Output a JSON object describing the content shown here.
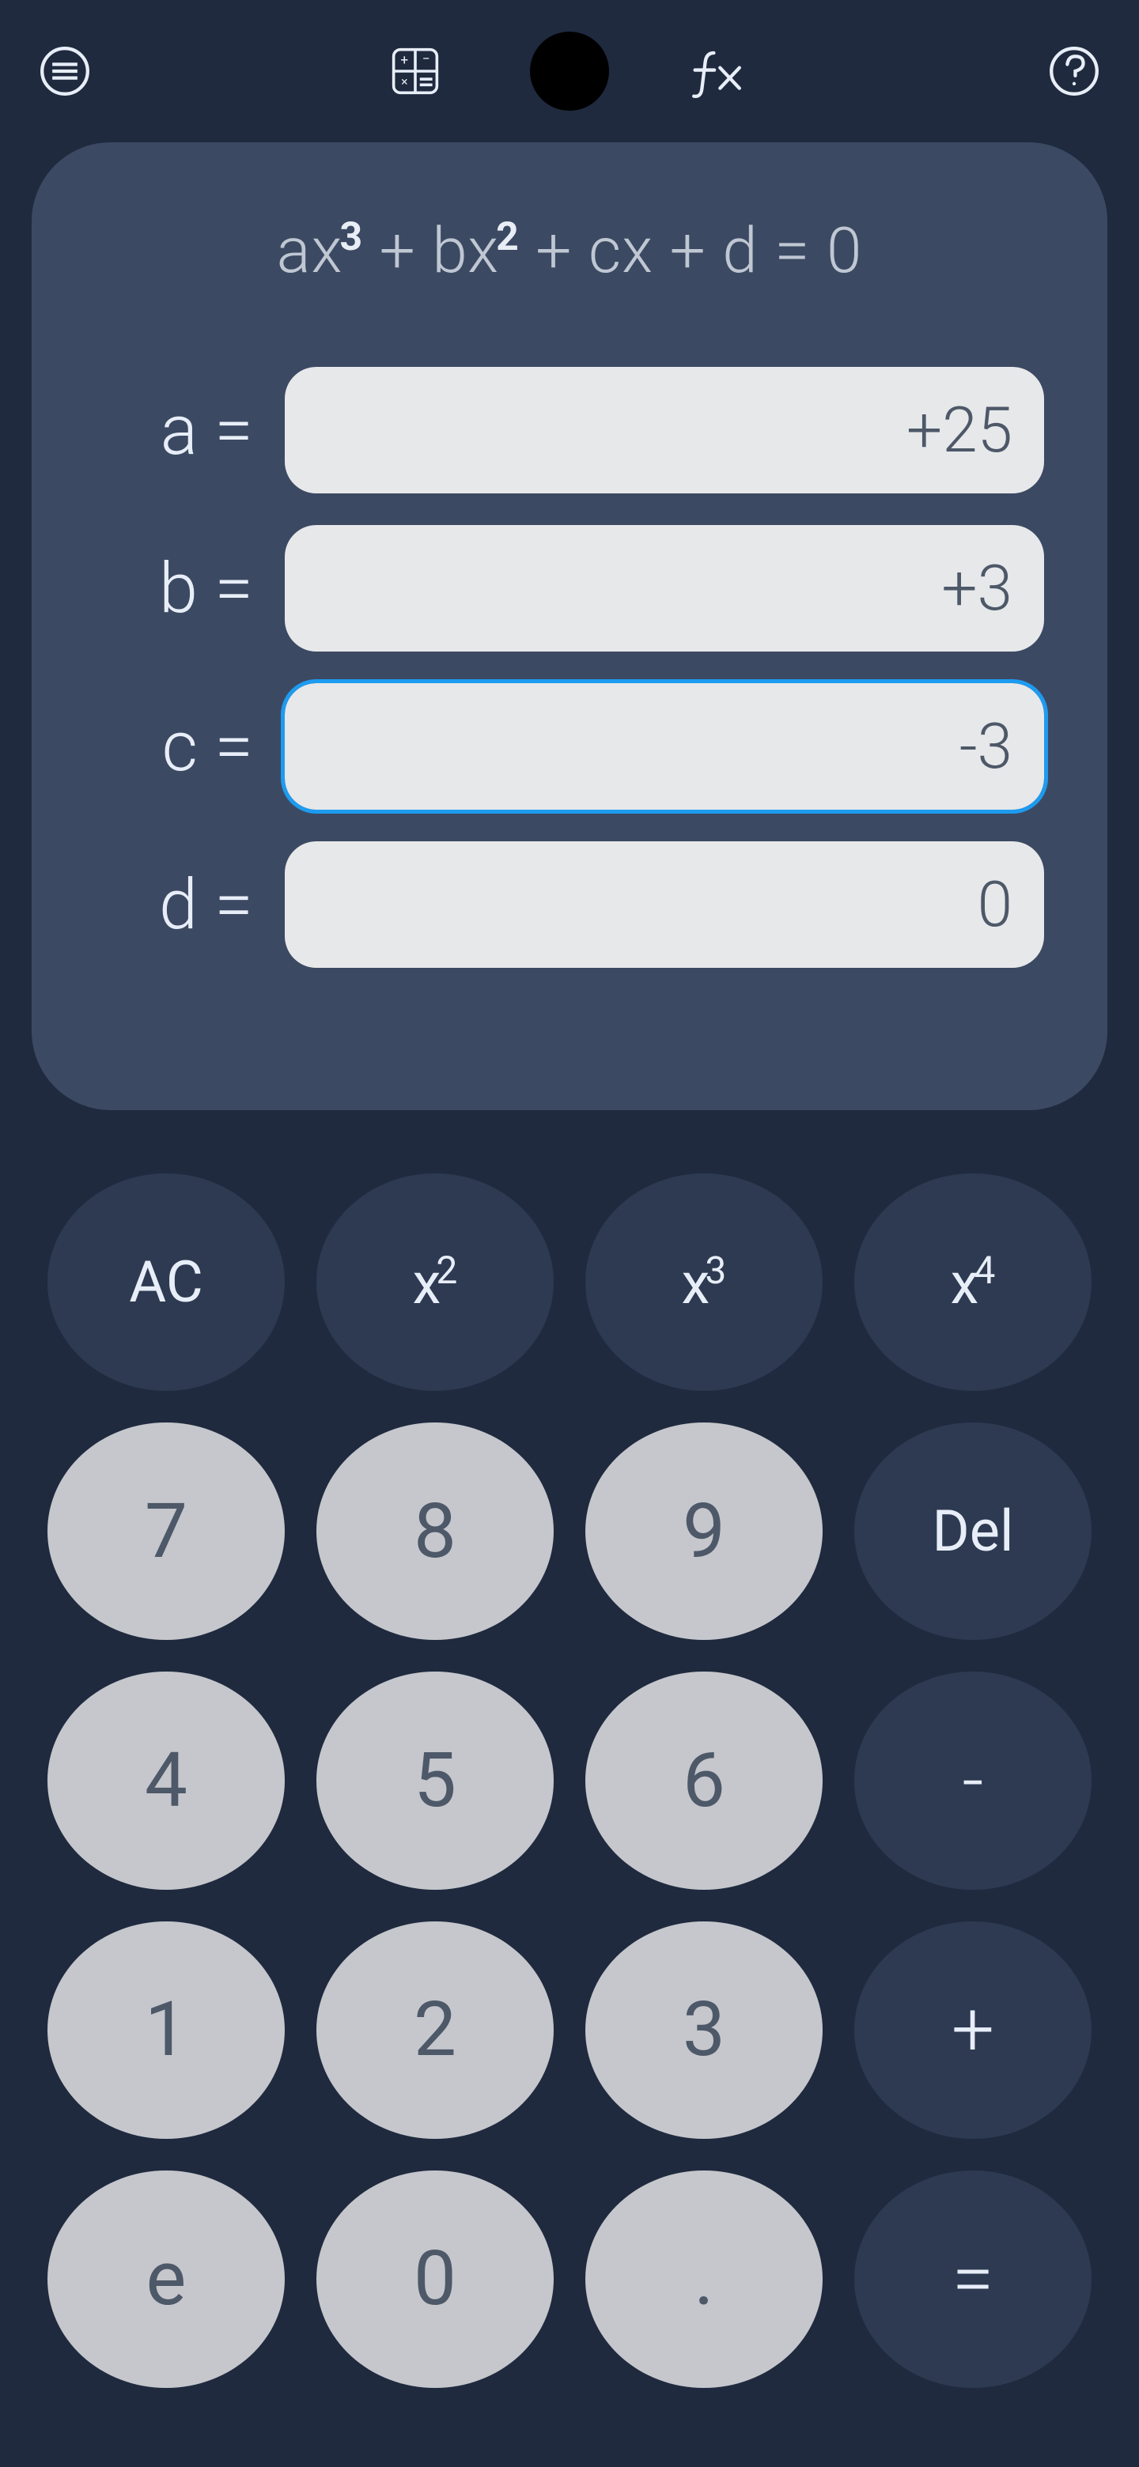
{
  "equation": {
    "html": "ax<sup>3</sup> + bx<sup>2</sup> + cx + d = 0"
  },
  "coefficients": [
    {
      "label": "a =",
      "value": "+25",
      "active": false
    },
    {
      "label": "b =",
      "value": "+3",
      "active": false
    },
    {
      "label": "c =",
      "value": "-3",
      "active": true
    },
    {
      "label": "d =",
      "value": "0",
      "active": false
    }
  ],
  "keypad": {
    "ac": "AC",
    "x2": "x²",
    "x3": "x³",
    "x4": "x⁴",
    "del": "Del",
    "minus": "-",
    "plus": "+",
    "equals": "=",
    "digits": {
      "7": "7",
      "8": "8",
      "9": "9",
      "4": "4",
      "5": "5",
      "6": "6",
      "1": "1",
      "2": "2",
      "3": "3",
      "e": "e",
      "0": "0",
      "dot": "."
    }
  }
}
